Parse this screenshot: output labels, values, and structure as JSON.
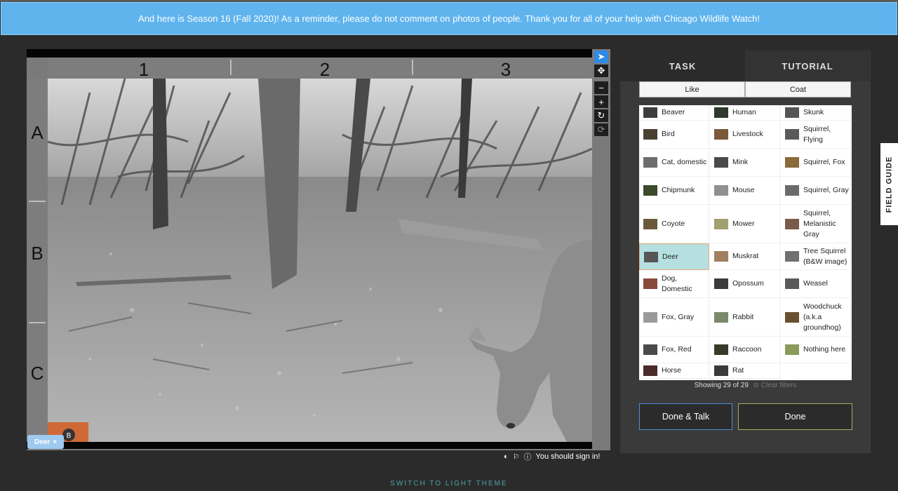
{
  "banner": {
    "text": "And here is Season 16 (Fall 2020)! As a reminder, please do not comment on photos of people. Thank you for all of your help with Chicago Wildlife Watch!"
  },
  "viewer": {
    "columns": [
      "1",
      "2",
      "3"
    ],
    "rows": [
      "A",
      "B",
      "C"
    ],
    "tools": [
      {
        "name": "pointer-icon",
        "glyph": "➤",
        "active": true
      },
      {
        "name": "move-icon",
        "glyph": "✥",
        "active": false
      },
      {
        "name": "zoom-out-icon",
        "glyph": "−",
        "active": false
      },
      {
        "name": "zoom-in-icon",
        "glyph": "+",
        "active": false
      },
      {
        "name": "rotate-icon",
        "glyph": "↻",
        "active": false
      },
      {
        "name": "reset-icon",
        "glyph": "⟳",
        "active": false
      }
    ],
    "annotation_tag": "Deer",
    "annotation_remove": "×",
    "sign_in_text": "You should sign in!"
  },
  "panel": {
    "tabs": {
      "task": "TASK",
      "tutorial": "TUTORIAL"
    },
    "filters": {
      "like": "Like",
      "coat": "Coat"
    },
    "choices": [
      {
        "label": "Beaver",
        "color": "#3d3d3d"
      },
      {
        "label": "Human",
        "color": "#2d3a2d"
      },
      {
        "label": "Skunk",
        "color": "#555555"
      },
      {
        "label": "Bird",
        "color": "#4a4032"
      },
      {
        "label": "Livestock",
        "color": "#7a5a3a"
      },
      {
        "label": "Squirrel, Flying",
        "color": "#5a5a5a"
      },
      {
        "label": "Cat, domestic",
        "color": "#6d6d6d"
      },
      {
        "label": "Mink",
        "color": "#4a4a4a"
      },
      {
        "label": "Squirrel, Fox",
        "color": "#8a6a3a"
      },
      {
        "label": "Chipmunk",
        "color": "#3a4a2a"
      },
      {
        "label": "Mouse",
        "color": "#909090"
      },
      {
        "label": "Squirrel, Gray",
        "color": "#6a6a6a"
      },
      {
        "label": "Coyote",
        "color": "#6a5a3a"
      },
      {
        "label": "Mower",
        "color": "#a0a070"
      },
      {
        "label": "Squirrel, Melanistic Gray",
        "color": "#7a5a4a"
      },
      {
        "label": "Deer",
        "color": "#555555"
      },
      {
        "label": "Muskrat",
        "color": "#a08060"
      },
      {
        "label": "Tree Squirrel (B&W image)",
        "color": "#707070"
      },
      {
        "label": "Dog, Domestic",
        "color": "#8a4a3a"
      },
      {
        "label": "Opossum",
        "color": "#3a3a3a"
      },
      {
        "label": "Weasel",
        "color": "#5a5a5a"
      },
      {
        "label": "Fox, Gray",
        "color": "#9a9a9a"
      },
      {
        "label": "Rabbit",
        "color": "#7a8a6a"
      },
      {
        "label": "Woodchuck (a.k.a groundhog)",
        "color": "#6a5030"
      },
      {
        "label": "Fox, Red",
        "color": "#4a4a4a"
      },
      {
        "label": "Raccoon",
        "color": "#3a3a2a"
      },
      {
        "label": "Nothing here",
        "color": "#8a9a5a"
      },
      {
        "label": "Horse",
        "color": "#4a2a2a"
      },
      {
        "label": "Rat",
        "color": "#3a3a3a"
      }
    ],
    "selected": "Deer",
    "showing": "Showing 29 of 29",
    "clear_filters": "⊘ Clear filters",
    "done_talk": "Done & Talk",
    "done": "Done"
  },
  "field_guide": "FIELD GUIDE",
  "theme_link": "SWITCH TO LIGHT THEME"
}
